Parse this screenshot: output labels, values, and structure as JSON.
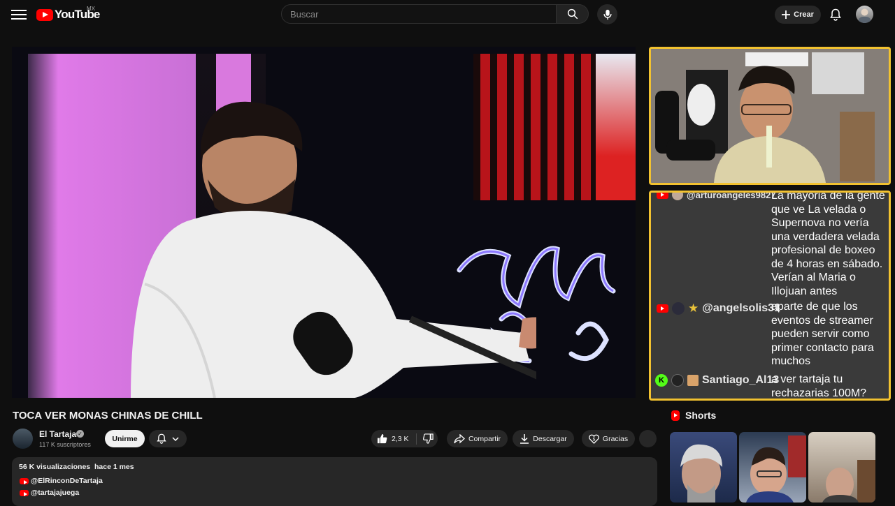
{
  "header": {
    "logo_text": "YouTube",
    "country_code": "MX",
    "search_placeholder": "Buscar",
    "create_label": "Crear"
  },
  "video": {
    "title": "TOCA VER MONAS CHINAS DE CHILL"
  },
  "channel": {
    "name": "El Tartaja",
    "verified_mark": "✓",
    "subscribers": "117 K suscriptores",
    "join_label": "Unirme"
  },
  "actions": {
    "likes": "2,3 K",
    "share_label": "Compartir",
    "download_label": "Descargar",
    "thanks_label": "Gracias"
  },
  "description": {
    "views": "56 K visualizaciones",
    "date": "hace 1 mes",
    "links": [
      "@ElRinconDeTartaja",
      "@tartajajuega"
    ]
  },
  "chat": {
    "messages": [
      {
        "user": "@arturoangeles9827",
        "text": "La mayoria de la gente que ve La velada o Supernova no vería una verdadera velada profesional de boxeo de 4 horas en sábado. Verían al Maria o Illojuan antes"
      },
      {
        "user": "@angelsolis31",
        "text": "aparte de que los eventos de streamer pueden servir como primer contacto para muchos"
      },
      {
        "user": "Santiago_Al13",
        "text": "a ver tartaja tu rechazarias 100M?"
      }
    ]
  },
  "shorts": {
    "heading": "Shorts"
  },
  "colors": {
    "accent_red": "#ff0000",
    "overlay_border": "#f2c230",
    "background": "#0f0f0f"
  }
}
